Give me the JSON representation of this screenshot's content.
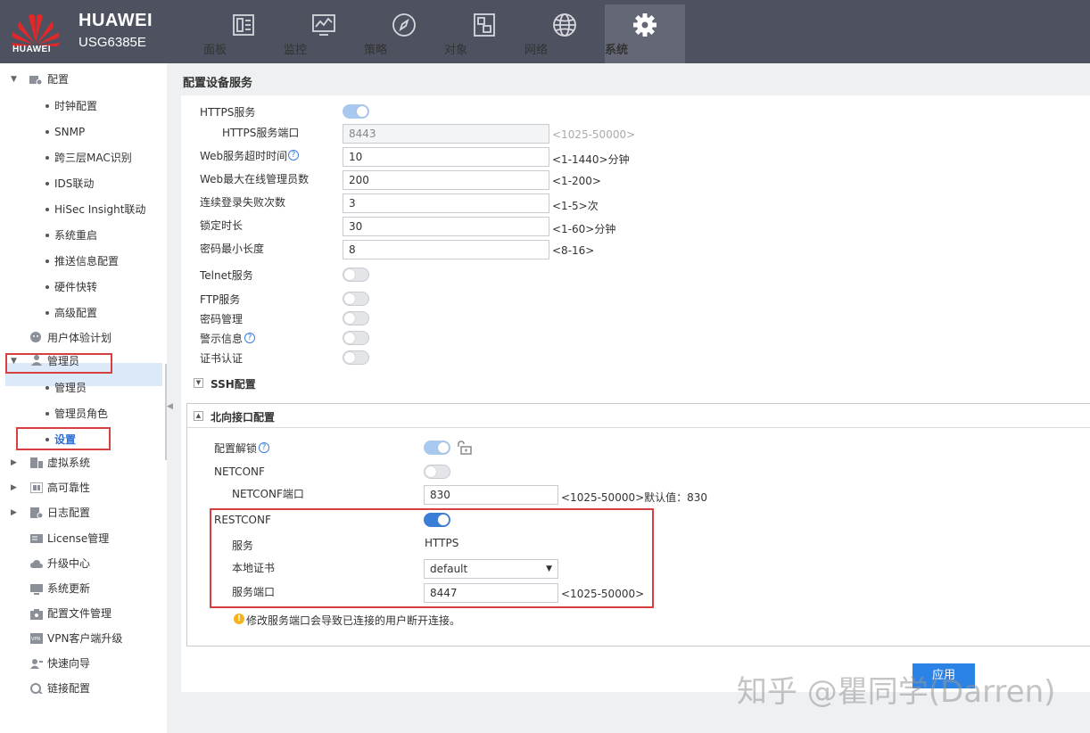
{
  "header": {
    "logo_text": "HUAWEI",
    "brand": "HUAWEI",
    "model": "USG6385E",
    "tabs": [
      {
        "label": "面板",
        "icon": "dashboard-icon"
      },
      {
        "label": "监控",
        "icon": "monitor-icon"
      },
      {
        "label": "策略",
        "icon": "policy-compass-icon"
      },
      {
        "label": "对象",
        "icon": "object-icon"
      },
      {
        "label": "网络",
        "icon": "network-globe-icon"
      },
      {
        "label": "系统",
        "icon": "gear-icon",
        "active": true
      }
    ]
  },
  "sidebar": {
    "items": [
      {
        "label": "配置"
      },
      {
        "label": "时钟配置"
      },
      {
        "label": "SNMP"
      },
      {
        "label": "跨三层MAC识别"
      },
      {
        "label": "IDS联动"
      },
      {
        "label": "HiSec Insight联动"
      },
      {
        "label": "系统重启"
      },
      {
        "label": "推送信息配置"
      },
      {
        "label": "硬件快转"
      },
      {
        "label": "高级配置"
      },
      {
        "label": "用户体验计划"
      },
      {
        "label": "管理员"
      },
      {
        "label": "管理员"
      },
      {
        "label": "管理员角色"
      },
      {
        "label": "设置"
      },
      {
        "label": "虚拟系统"
      },
      {
        "label": "高可靠性"
      },
      {
        "label": "日志配置"
      },
      {
        "label": "License管理"
      },
      {
        "label": "升级中心"
      },
      {
        "label": "系统更新"
      },
      {
        "label": "配置文件管理"
      },
      {
        "label": "VPN客户端升级"
      },
      {
        "label": "快速向导"
      },
      {
        "label": "链接配置"
      }
    ]
  },
  "main": {
    "title": "配置设备服务",
    "https_service": "HTTPS服务",
    "https_port_label": "HTTPS服务端口",
    "https_port_value": "8443",
    "https_port_hint": "<1025-50000>",
    "web_timeout_label": "Web服务超时时间",
    "web_timeout_value": "10",
    "web_timeout_hint": "<1-1440>分钟",
    "web_max_admin_label": "Web最大在线管理员数",
    "web_max_admin_value": "200",
    "web_max_admin_hint": "<1-200>",
    "login_fail_label": "连续登录失败次数",
    "login_fail_value": "3",
    "login_fail_hint": "<1-5>次",
    "lock_time_label": "锁定时长",
    "lock_time_value": "30",
    "lock_time_hint": "<1-60>分钟",
    "pwd_min_label": "密码最小长度",
    "pwd_min_value": "8",
    "pwd_min_hint": "<8-16>",
    "telnet_label": "Telnet服务",
    "ftp_label": "FTP服务",
    "pwd_mgmt_label": "密码管理",
    "warning_info_label": "警示信息",
    "cert_auth_label": "证书认证",
    "ssh_section": "SSH配置",
    "north_section": "北向接口配置",
    "config_unlock_label": "配置解锁",
    "netconf_label": "NETCONF",
    "netconf_port_label": "NETCONF端口",
    "netconf_port_value": "830",
    "netconf_port_hint": "<1025-50000>默认值：830",
    "restconf_label": "RESTCONF",
    "service_label": "服务",
    "service_value": "HTTPS",
    "local_cert_label": "本地证书",
    "local_cert_value": "default",
    "service_port_label": "服务端口",
    "service_port_value": "8447",
    "service_port_hint": "<1025-50000>",
    "warning_note": "修改服务端口会导致已连接的用户断开连接。",
    "apply_label": "应用",
    "help_glyph": "?",
    "warn_glyph": "!"
  },
  "watermark": "知乎 @瞿同学(Darren)",
  "colors": {
    "topbar": "#4e5260",
    "active_tab": "#646876",
    "toggle_on": "#3b7ed8",
    "highlight": "#d64040",
    "apply": "#2c83e6",
    "huawei_red": "#e02828"
  }
}
